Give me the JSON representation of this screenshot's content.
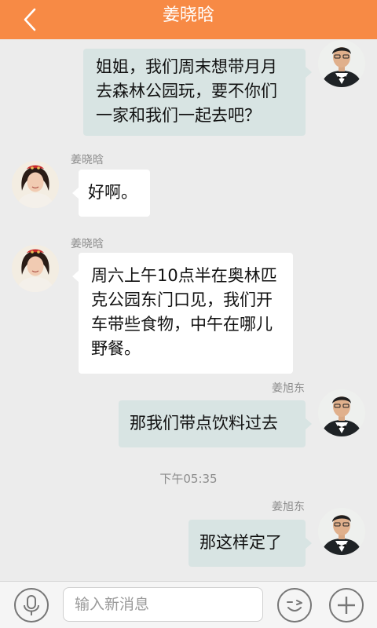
{
  "header": {
    "title": "姜晓晗",
    "back_icon": "chevron-left-icon"
  },
  "messages": [
    {
      "side": "out",
      "sender": "",
      "text": "姐姐，我们周末想带月月去森林公园玩，要不你们一家和我们一起去吧？",
      "lines": [
        "姐姐，我们周末想带月月",
        "去森林公园玩，要不你们",
        "一家和我们一起去吧？"
      ]
    },
    {
      "side": "in",
      "sender": "姜晓晗",
      "text": "好啊。",
      "lines": [
        "好啊。"
      ]
    },
    {
      "side": "in",
      "sender": "姜晓晗",
      "text": "周六上午10点半在奥林匹克公园东门口见，我们开车带些食物，中午在哪儿野餐。",
      "lines": [
        "周六上午10点半在奥林匹",
        "克公园东门口见，我们开",
        "车带些食物，中午在哪儿",
        "野餐。"
      ]
    },
    {
      "side": "out",
      "sender": "姜旭东",
      "text": "那我们带点饮料过去",
      "lines": [
        "那我们带点饮料过去"
      ]
    },
    {
      "side": "out",
      "sender": "姜旭东",
      "text": "那这样定了",
      "lines": [
        "那这样定了"
      ]
    }
  ],
  "timestamp": "下午05:35",
  "input_bar": {
    "placeholder": "输入新消息",
    "voice_icon": "microphone-icon",
    "emoji_icon": "wink-emoji-icon",
    "more_icon": "plus-icon"
  },
  "colors": {
    "header": "#f78a45",
    "outgoing_bubble": "#d8e4e3",
    "incoming_bubble": "#ffffff",
    "background": "#ececec"
  }
}
